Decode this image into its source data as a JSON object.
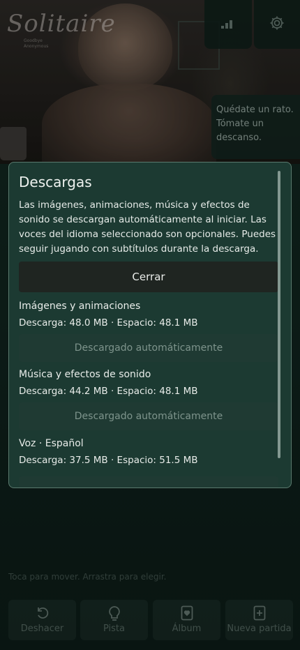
{
  "app": {
    "logo": "Solitaire",
    "logo_sub": "Goodbye Anonymous",
    "hint": "Toca para mover. Arrastra para elegir.",
    "tip": "Quédate un rato. Tómate un descanso."
  },
  "bottom_bar": {
    "undo": "Deshacer",
    "hint": "Pista",
    "album": "Álbum",
    "new_game": "Nueva partida"
  },
  "dialog": {
    "title": "Descargas",
    "description": "Las imágenes, animaciones, música y efectos de sonido se descargan automáticamente al iniciar. Las voces del idioma seleccionado son opcionales. Puedes seguir jugando con subtítulos durante la descarga.",
    "close_label": "Cerrar",
    "sections": [
      {
        "name": "Imágenes y animaciones",
        "stats": "Descarga: 48.0 MB · Espacio: 48.1 MB",
        "status": "Descargado automáticamente"
      },
      {
        "name": "Música y efectos de sonido",
        "stats": "Descarga: 44.2 MB · Espacio: 48.1 MB",
        "status": "Descargado automáticamente"
      },
      {
        "name": "Voz · Español",
        "stats": "Descarga: 37.5 MB · Espacio: 51.5 MB"
      }
    ]
  },
  "colors": {
    "dialog_bg": "#1c3a32",
    "dialog_border": "#5a7a6e",
    "close_button_bg": "#1f2521",
    "auto_button_bg": "#1f3a33",
    "auto_button_text": "#7e948c"
  }
}
